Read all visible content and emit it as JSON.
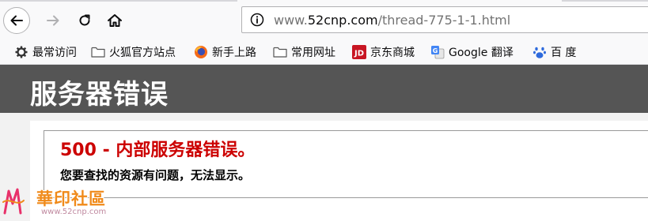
{
  "browser": {
    "url_prefix": "www.",
    "url_domain": "52cnp.com",
    "url_path": "/thread-775-1-1.html"
  },
  "bookmarks": [
    {
      "label": "最常访问",
      "icon": "gear-icon"
    },
    {
      "label": "火狐官方站点",
      "icon": "folder-icon"
    },
    {
      "label": "新手上路",
      "icon": "firefox-icon"
    },
    {
      "label": "常用网址",
      "icon": "folder-icon"
    },
    {
      "label": "京东商城",
      "icon": "jd-icon"
    },
    {
      "label": "Google 翻译",
      "icon": "google-translate-icon"
    },
    {
      "label": "百 度",
      "icon": "baidu-paw-icon"
    }
  ],
  "page": {
    "header_title": "服务器错误",
    "error_heading": "500 - 内部服务器错误。",
    "error_message": "您要查找的资源有问题，无法显示。"
  },
  "watermark": {
    "title": "華印社區",
    "url": "www.52cnp.com"
  },
  "colors": {
    "header_bg": "#555555",
    "error_red": "#cc0000",
    "watermark_orange": "#f08a1a"
  }
}
